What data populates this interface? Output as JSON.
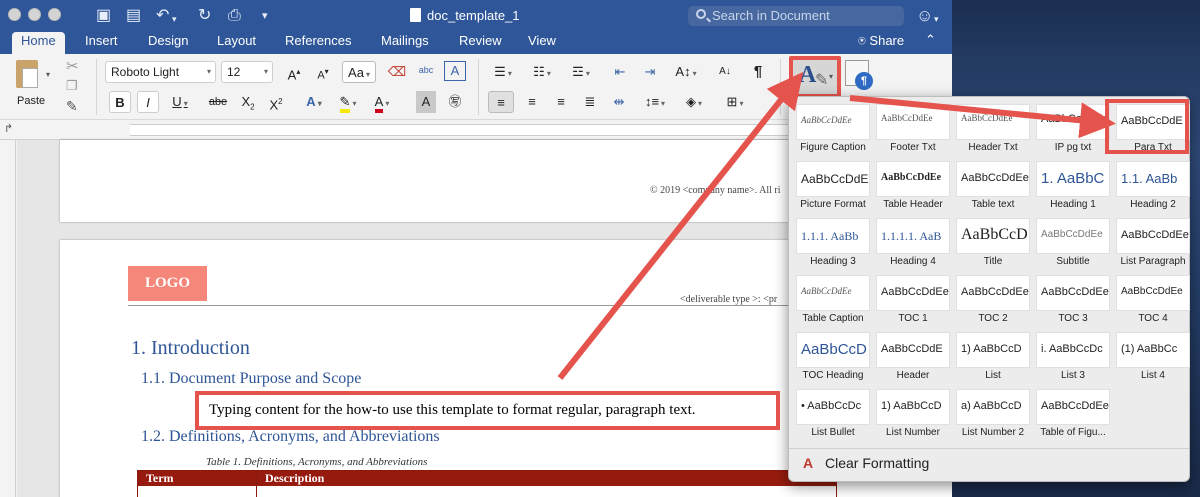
{
  "window": {
    "title": "doc_template_1",
    "search_placeholder": "Search in Document"
  },
  "tabs": [
    {
      "label": "Home",
      "active": true
    },
    {
      "label": "Insert"
    },
    {
      "label": "Design"
    },
    {
      "label": "Layout"
    },
    {
      "label": "References"
    },
    {
      "label": "Mailings"
    },
    {
      "label": "Review"
    },
    {
      "label": "View"
    }
  ],
  "share_label": "Share",
  "toolbar": {
    "paste_label": "Paste",
    "font_name": "Roboto Light",
    "font_size": "12",
    "grow_font": "A",
    "shrink_font": "A",
    "change_case": "Aa",
    "bold": "B",
    "italic": "I",
    "underline": "U",
    "strikethrough": "abe",
    "subscript": "X",
    "superscript": "X",
    "text_effects": "A",
    "font_color": "A",
    "shading": "A",
    "sort": "A↓",
    "pilcrow": "¶",
    "clear": "abc"
  },
  "document": {
    "footer_text": "© 2019 <company name>. All ri",
    "logo": "LOGO",
    "header_right": "<deliverable type >:  <pr",
    "h1": "1.  Introduction",
    "h2_1": "1.1. Document Purpose and Scope",
    "h2_2": "1.2. Definitions, Acronyms, and Abbreviations",
    "table_caption": "Table 1. Definitions, Acronyms, and Abbreviations",
    "table_headers": [
      "Term",
      "Description"
    ],
    "callout": "Typing content for the how-to use this template to format regular, paragraph text."
  },
  "styles_gallery": [
    {
      "name": "Figure Caption",
      "preview": "AaBbCcDdEe"
    },
    {
      "name": "Footer Txt",
      "preview": "AaBbCcDdEe"
    },
    {
      "name": "Header Txt",
      "preview": "AaBbCcDdEe"
    },
    {
      "name": "IP pg txt",
      "preview": "AaBbCcDdEe"
    },
    {
      "name": "Para Txt",
      "preview": "AaBbCcDdE"
    },
    {
      "name": "Picture Format",
      "preview": "AaBbCcDdE"
    },
    {
      "name": "Table Header",
      "preview": "AaBbCcDdEe"
    },
    {
      "name": "Table text",
      "preview": "AaBbCcDdEe"
    },
    {
      "name": "Heading 1",
      "preview": "1.  AaBbC"
    },
    {
      "name": "Heading 2",
      "preview": "1.1.  AaBb"
    },
    {
      "name": "Heading 3",
      "preview": "1.1.1.  AaBb"
    },
    {
      "name": "Heading 4",
      "preview": "1.1.1.1.  AaB"
    },
    {
      "name": "Title",
      "preview": "AaBbCcD"
    },
    {
      "name": "Subtitle",
      "preview": "AaBbCcDdEe"
    },
    {
      "name": "List Paragraph",
      "preview": "AaBbCcDdEe"
    },
    {
      "name": "Table Caption",
      "preview": "AaBbCcDdEe"
    },
    {
      "name": "TOC 1",
      "preview": "AaBbCcDdEe"
    },
    {
      "name": "TOC 2",
      "preview": "AaBbCcDdEe"
    },
    {
      "name": "TOC 3",
      "preview": "AaBbCcDdEe"
    },
    {
      "name": "TOC 4",
      "preview": "AaBbCcDdEe"
    },
    {
      "name": "TOC Heading",
      "preview": "AaBbCcD"
    },
    {
      "name": "Header",
      "preview": "AaBbCcDdE"
    },
    {
      "name": "List",
      "preview": "1)  AaBbCcD"
    },
    {
      "name": "List 3",
      "preview": "i.  AaBbCcDc"
    },
    {
      "name": "List 4",
      "preview": "(1)  AaBbCc"
    },
    {
      "name": "List Bullet",
      "preview": "•  AaBbCcDc"
    },
    {
      "name": "List Number",
      "preview": "1)  AaBbCcD"
    },
    {
      "name": "List Number 2",
      "preview": "a)  AaBbCcD"
    },
    {
      "name": "Table of Figu...",
      "preview": "AaBbCcDdEe"
    }
  ],
  "clear_formatting_label": "Clear Formatting",
  "colors": {
    "title_bar": "#2f5699",
    "highlight": "#e5544c",
    "heading": "#2e5596",
    "table_header": "#961b0e",
    "logo": "#f4877a"
  }
}
